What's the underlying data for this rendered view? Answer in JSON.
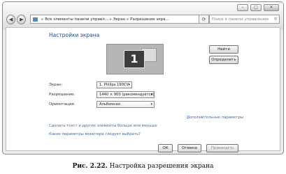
{
  "window": {
    "controls": [
      "–",
      "□",
      "✕"
    ],
    "address": {
      "crumbs": [
        "Все элементы панели управл...",
        "Экран",
        "Разрешение экра..."
      ],
      "search_placeholder": "Поиск в панели управления"
    }
  },
  "page": {
    "title": "Настройки экрана",
    "monitor_number": "1",
    "find_button": "Найти",
    "identify_button": "Определить",
    "fields": {
      "screen_label": "Экран:",
      "screen_value": "1. Philips 190CV",
      "resolution_label": "Разрешение:",
      "resolution_value": "1440 × 900 (рекомендуется)",
      "orientation_label": "Ориентация:",
      "orientation_value": "Альбомная"
    },
    "advanced_link": "Дополнительные параметры",
    "link_text_size": "Сделать текст и другие элементы больше или меньше",
    "link_which_settings": "Какие параметры монитора следует выбрать?",
    "ok_button": "ОК",
    "cancel_button": "Отмена",
    "apply_button": "Применить"
  },
  "caption": {
    "figure": "Рис. 2.22.",
    "text": "Настройка разрешения экрана"
  }
}
